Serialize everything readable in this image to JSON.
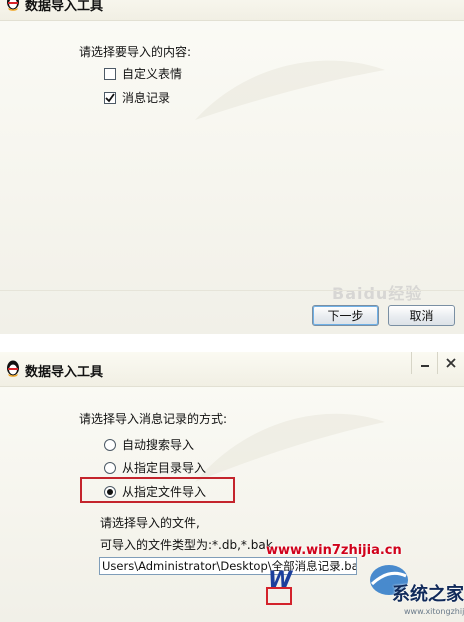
{
  "dialog1": {
    "title": "数据导入工具",
    "prompt": "请选择要导入的内容:",
    "options": [
      {
        "label": "自定义表情",
        "checked": false
      },
      {
        "label": "消息记录",
        "checked": true
      }
    ],
    "next_button": "下一步",
    "cancel_button": "取消",
    "watermark": "Baidu经验"
  },
  "dialog2": {
    "title": "数据导入工具",
    "prompt": "请选择导入消息记录的方式:",
    "options": [
      {
        "label": "自动搜索导入",
        "selected": false
      },
      {
        "label": "从指定目录导入",
        "selected": false
      },
      {
        "label": "从指定文件导入",
        "selected": true
      }
    ],
    "file_prompt": "请选择导入的文件,",
    "file_types": "可导入的文件类型为:*.db,*.bak",
    "file_path": "Users\\Administrator\\Desktop\\全部消息记录.bak"
  },
  "overlay": {
    "site_url": "www.win7zhijia.cn",
    "logo_letter": "W",
    "logo_name": "系统之家",
    "logo_small": "www.xitongzhijia.net"
  },
  "colors": {
    "highlight": "#c4242c",
    "button_border": "#7a8fa3",
    "site_url": "#d0021b"
  },
  "icons": [
    "qq-penguin-icon",
    "minimize-icon",
    "close-icon",
    "checkbox-icon",
    "radio-icon"
  ]
}
